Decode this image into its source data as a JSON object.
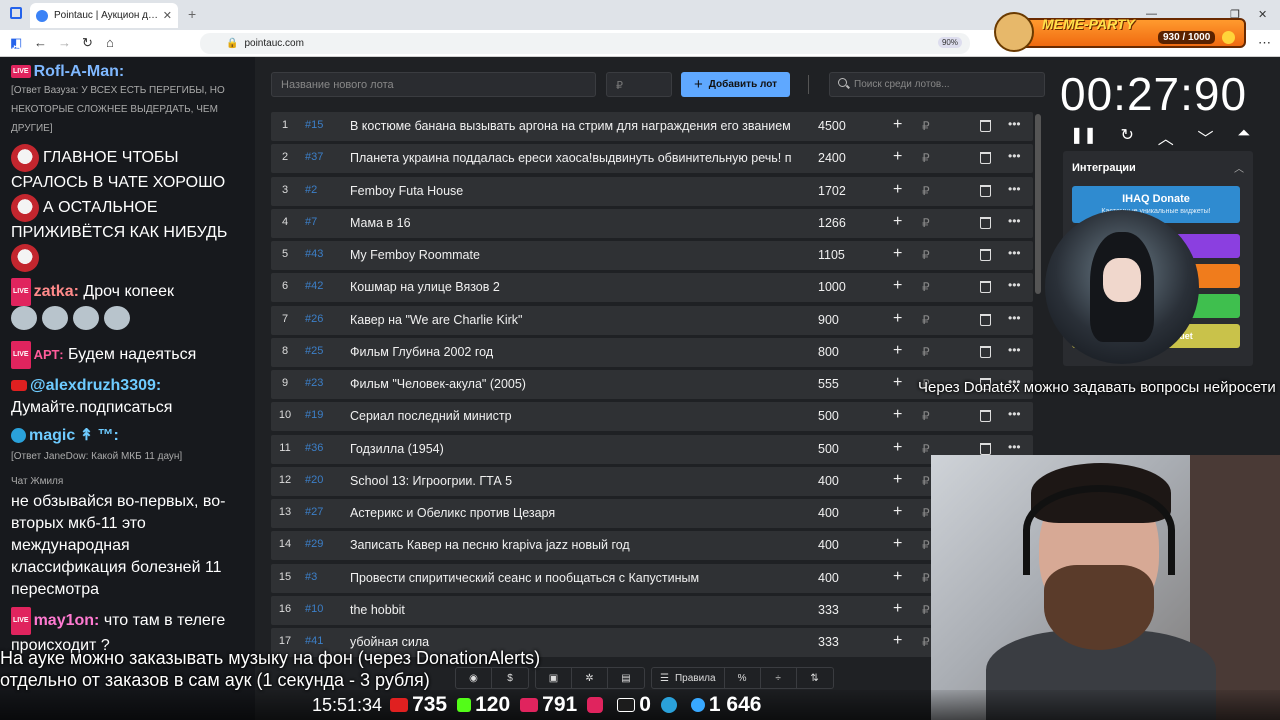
{
  "browser": {
    "tab_title": "Pointauc | Аукцион для стримера",
    "url": "pointauc.com",
    "zoom": "90%"
  },
  "meme_party": {
    "title": "MEME-PARTY",
    "count": "930 / 1000"
  },
  "toolbar": {
    "name_placeholder": "Название нового лота",
    "price_placeholder": "₽",
    "add_button": "Добавить лот",
    "search_placeholder": "Поиск среди лотов..."
  },
  "lots": [
    {
      "num": "1",
      "id": "#15",
      "name": "В костюме банана вызывать аргона на стрим для награждения его званием",
      "amount": "4500"
    },
    {
      "num": "2",
      "id": "#37",
      "name": "Планета украина поддалась ереси хаоса!выдвинуть обвинительную речь! по",
      "amount": "2400"
    },
    {
      "num": "3",
      "id": "#2",
      "name": "Femboy Futa House",
      "amount": "1702"
    },
    {
      "num": "4",
      "id": "#7",
      "name": "Мама в 16",
      "amount": "1266"
    },
    {
      "num": "5",
      "id": "#43",
      "name": "My Femboy Roommate",
      "amount": "1105"
    },
    {
      "num": "6",
      "id": "#42",
      "name": "Кошмар на улице Вязов 2",
      "amount": "1000"
    },
    {
      "num": "7",
      "id": "#26",
      "name": "Кавер на \"We are Charlie Kirk\"",
      "amount": "900"
    },
    {
      "num": "8",
      "id": "#25",
      "name": "Фильм Глубина 2002 год",
      "amount": "800"
    },
    {
      "num": "9",
      "id": "#23",
      "name": "Фильм \"Человек-акула\" (2005)",
      "amount": "555"
    },
    {
      "num": "10",
      "id": "#19",
      "name": "Сериал последний министр",
      "amount": "500"
    },
    {
      "num": "11",
      "id": "#36",
      "name": "Годзилла (1954)",
      "amount": "500"
    },
    {
      "num": "12",
      "id": "#20",
      "name": "School 13: Игроогрии. ГТА 5",
      "amount": "400"
    },
    {
      "num": "13",
      "id": "#27",
      "name": "Астерикс и Обеликс против Цезаря",
      "amount": "400"
    },
    {
      "num": "14",
      "id": "#29",
      "name": "Записать Кавер на песню kraрiva jazz новый год",
      "amount": "400"
    },
    {
      "num": "15",
      "id": "#3",
      "name": "Провести спиритический сеанс и пообщаться с Капустиным",
      "amount": "400"
    },
    {
      "num": "16",
      "id": "#10",
      "name": "the hobbit",
      "amount": "333"
    },
    {
      "num": "17",
      "id": "#41",
      "name": "убойная сила",
      "amount": "333"
    }
  ],
  "currency": "₽",
  "timer": {
    "value": "00:27:90"
  },
  "integrations": {
    "title": "Интеграции",
    "ihaq_label": "IHAQ Donate",
    "ihaq_sub": "Кастомные уникальные виджеты!",
    "bouquet_label": "uet"
  },
  "bottom_toolbar": {
    "rules": "Правила",
    "percent": "%"
  },
  "chat": {
    "messages": [
      {
        "user": "Rofl-A-Man:",
        "reply": "[Ответ Вазуза: У ВСЕХ ЕСТЬ ПЕРЕГИБЫ, НО НЕКОТОРЫЕ СЛОЖНЕЕ ВЫДЕРДАТЬ, ЧЕМ ДРУГИЕ]"
      },
      {
        "text1": "ГЛАВНОЕ ЧТОБЫ",
        "text2": "СРАЛОСЬ В ЧАТЕ ХОРОШО",
        "text3": "А ОСТАЛЬНОЕ",
        "text4": "ПРИЖИВЁТСЯ КАК НИБУДЬ"
      },
      {
        "user": "zatka:",
        "text": "Дроч копеек"
      },
      {
        "user": "АРТ:",
        "text": "Будем надеяться"
      },
      {
        "user": "@alexdruzh3309:",
        "text": "Думайте.подписаться"
      },
      {
        "user": "magic ↟ ™:",
        "reply": "[Ответ JaneDow: Какой МКБ 11 даун]"
      },
      {
        "user": "Чат Жмиля",
        "text": "не обзывайся во-первых, во-вторых мкб-11 это международная классификация болезней 11 пересмотра"
      },
      {
        "user": "may1on:",
        "text": "что там в телеге происходит ?"
      }
    ]
  },
  "subtitles": {
    "line1": "На ауке можно заказывать музыку на фон (через DonationAlerts)",
    "line2": "отдельно от заказов в сам аук (1 секунда - 3 рубля)",
    "right": "Через Donatex можно задавать вопросы нейросети"
  },
  "stats": {
    "time": "15:51:34",
    "youtube": "735",
    "kick": "120",
    "live": "791",
    "rutube": "0",
    "telegram": "",
    "viewers": "1 646"
  },
  "colors": {
    "accent": "#5fa8ff",
    "id_link": "#3c7fc8",
    "bg": "#1f2124"
  }
}
